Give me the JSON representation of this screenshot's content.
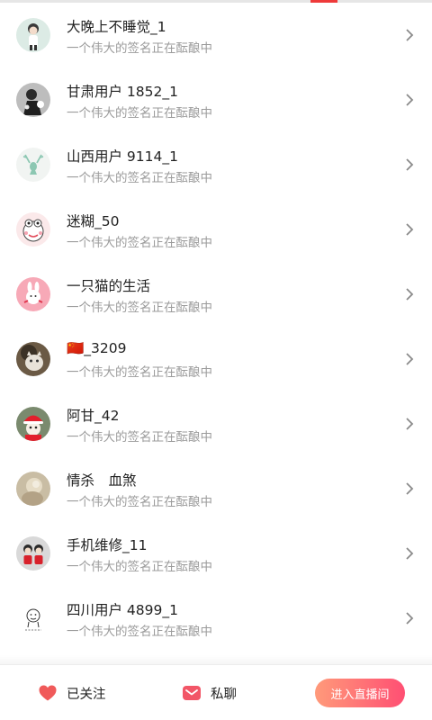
{
  "users": [
    {
      "name": "大晚上不睡觉_1",
      "signature": "一个伟大的签名正在酝酿中",
      "avatar_icon": "cartoon-girl-avatar"
    },
    {
      "name": "甘肃用户 1852_1",
      "signature": "一个伟大的签名正在酝酿中",
      "avatar_icon": "dark-figure-avatar"
    },
    {
      "name": "山西用户 9114_1",
      "signature": "一个伟大的签名正在酝酿中",
      "avatar_icon": "deer-head-avatar"
    },
    {
      "name": "迷糊_50",
      "signature": "一个伟大的签名正在酝酿中",
      "avatar_icon": "cartoon-face-avatar"
    },
    {
      "name": "一只猫的生活",
      "signature": "一个伟大的签名正在酝酿中",
      "avatar_icon": "bunny-avatar"
    },
    {
      "name": "🇨🇳_3209",
      "signature": "一个伟大的签名正在酝酿中",
      "avatar_icon": "cat-photo-avatar"
    },
    {
      "name": "阿甘_42",
      "signature": "一个伟大的签名正在酝酿中",
      "avatar_icon": "red-hat-avatar"
    },
    {
      "name": "情杀　血煞",
      "signature": "一个伟大的签名正在酝酿中",
      "avatar_icon": "blurred-photo-avatar"
    },
    {
      "name": "手机维修_11",
      "signature": "一个伟大的签名正在酝酿中",
      "avatar_icon": "couple-avatar"
    },
    {
      "name": "四川用户 4899_1",
      "signature": "一个伟大的签名正在酝酿中",
      "avatar_icon": "sketch-avatar"
    }
  ],
  "bottom_bar": {
    "follow_label": "已关注",
    "message_label": "私聊",
    "live_label": "进入直播间"
  },
  "colors": {
    "accent": "#ee3a3a",
    "heart": "#f05a5a",
    "live_button_start": "#ff9a7a",
    "live_button_end": "#ff4f73"
  }
}
